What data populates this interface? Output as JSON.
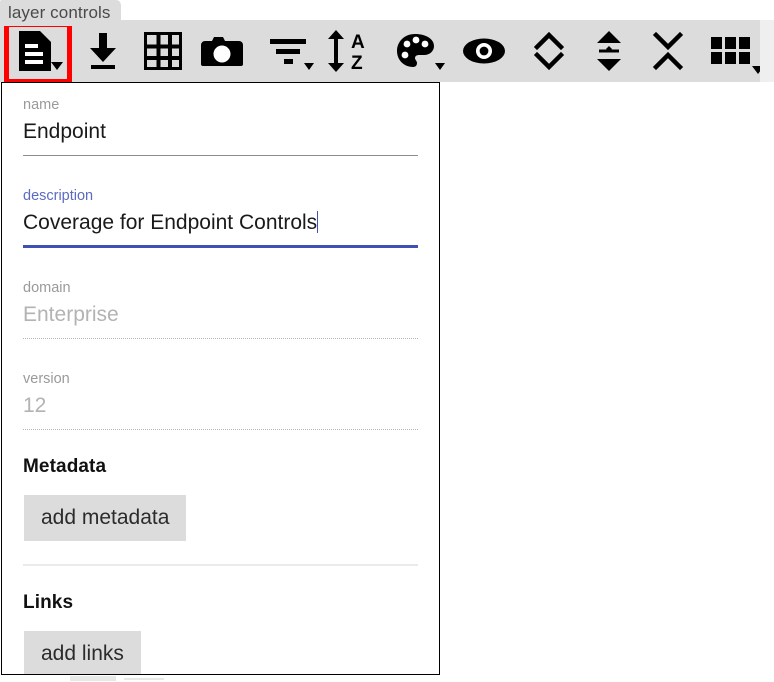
{
  "tooltip": {
    "label": "layer controls"
  },
  "colors": {
    "accent": "#3f51b5",
    "highlight": "#ff0000",
    "toolbar_bg": "#dcdcdc",
    "button_bg": "#dcdcdc",
    "disabled_text": "#b3b3b3",
    "label_text": "#9a9a9a"
  },
  "toolbar": {
    "buttons": [
      {
        "name": "layer-controls-button",
        "icon": "document-icon",
        "has_caret": true,
        "highlighted": true
      },
      {
        "name": "download-button",
        "icon": "download-icon",
        "has_caret": false,
        "highlighted": false
      },
      {
        "name": "grid-button",
        "icon": "grid-icon",
        "has_caret": false,
        "highlighted": false
      },
      {
        "name": "camera-button",
        "icon": "camera-icon",
        "has_caret": false,
        "highlighted": false
      },
      {
        "name": "filter-button",
        "icon": "filter-icon",
        "has_caret": true,
        "highlighted": false
      },
      {
        "name": "sort-button",
        "icon": "sort-az-icon",
        "has_caret": false,
        "highlighted": false
      },
      {
        "name": "color-palette-button",
        "icon": "palette-icon",
        "has_caret": true,
        "highlighted": false
      },
      {
        "name": "visibility-button",
        "icon": "eye-icon",
        "has_caret": false,
        "highlighted": false
      },
      {
        "name": "expand-rows-button",
        "icon": "chevron-up-down-icon",
        "has_caret": false,
        "highlighted": false
      },
      {
        "name": "expand-all-button",
        "icon": "expand-vertical-icon",
        "has_caret": false,
        "highlighted": false
      },
      {
        "name": "collapse-rows-button",
        "icon": "chevron-down-up-icon",
        "has_caret": false,
        "highlighted": false
      },
      {
        "name": "layout-button",
        "icon": "grid-blocks-icon",
        "has_caret": true,
        "highlighted": false
      }
    ]
  },
  "panel": {
    "fields": [
      {
        "key": "name",
        "label": "name",
        "value": "Endpoint",
        "placeholder": "name",
        "state": "filled",
        "focused": false,
        "disabled": false,
        "underline": "solid"
      },
      {
        "key": "description",
        "label": "description",
        "value": "Coverage for Endpoint Controls",
        "placeholder": "description",
        "state": "editing",
        "focused": true,
        "disabled": false,
        "underline": "active"
      },
      {
        "key": "domain",
        "label": "domain",
        "value": "Enterprise",
        "placeholder": "domain",
        "state": "readonly",
        "focused": false,
        "disabled": true,
        "underline": "dotted"
      },
      {
        "key": "version",
        "label": "version",
        "value": "12",
        "placeholder": "version",
        "state": "readonly",
        "focused": false,
        "disabled": true,
        "underline": "dotted"
      }
    ],
    "sections": [
      {
        "key": "metadata",
        "title": "Metadata",
        "button_label": "add metadata"
      },
      {
        "key": "links",
        "title": "Links",
        "button_label": "add links"
      }
    ]
  }
}
